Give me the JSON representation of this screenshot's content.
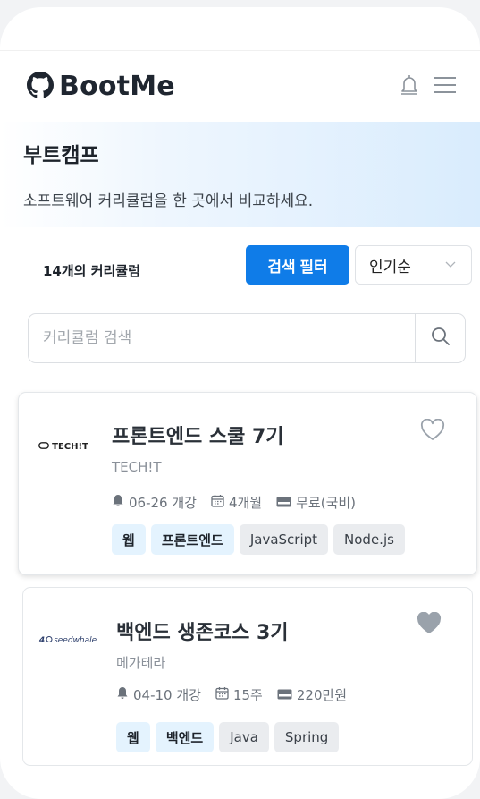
{
  "header": {
    "logo_text": "BootMe"
  },
  "hero": {
    "title": "부트캠프",
    "subtitle": "소프트웨어 커리큘럼을 한 곳에서 비교하세요."
  },
  "controls": {
    "count_label": "14개의 커리큘럼",
    "filter_label": "검색 필터",
    "sort_selected": "인기순"
  },
  "search": {
    "placeholder": "커리큘럼 검색"
  },
  "courses": [
    {
      "logo_text": "TECH!T",
      "title": "프론트엔드 스쿨 7기",
      "company": "TECH!T",
      "start": "06-26 개강",
      "duration": "4개월",
      "price": "무료(국비)",
      "tags": [
        "웹",
        "프론트엔드",
        "JavaScript",
        "Node.js"
      ],
      "favorited": false
    },
    {
      "logo_text": "seedwhale",
      "title": "백엔드 생존코스 3기",
      "company": "메가테라",
      "start": "04-10 개강",
      "duration": "15주",
      "price": "220만원",
      "tags": [
        "웹",
        "백엔드",
        "Java",
        "Spring"
      ],
      "favorited": true
    }
  ],
  "colors": {
    "primary": "#0f7ce8",
    "tag_primary_bg": "#e4f3fe",
    "tag_secondary_bg": "#eaecef"
  }
}
